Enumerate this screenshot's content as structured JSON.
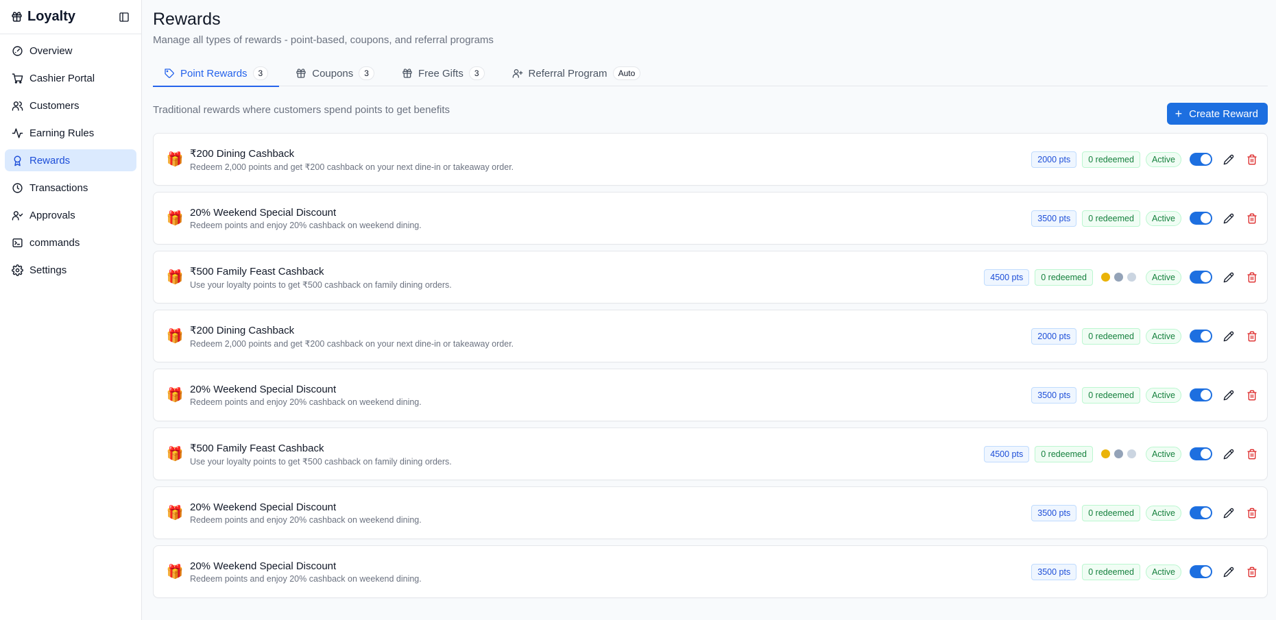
{
  "app": {
    "title": "Loyalty"
  },
  "sidebar": {
    "items": [
      {
        "label": "Overview",
        "icon": "gauge-icon",
        "active": false
      },
      {
        "label": "Cashier Portal",
        "icon": "cart-icon",
        "active": false
      },
      {
        "label": "Customers",
        "icon": "users-icon",
        "active": false
      },
      {
        "label": "Earning Rules",
        "icon": "activity-icon",
        "active": false
      },
      {
        "label": "Rewards",
        "icon": "award-icon",
        "active": true
      },
      {
        "label": "Transactions",
        "icon": "clock-icon",
        "active": false
      },
      {
        "label": "Approvals",
        "icon": "user-check-icon",
        "active": false
      },
      {
        "label": "commands",
        "icon": "terminal-icon",
        "active": false
      },
      {
        "label": "Settings",
        "icon": "gear-icon",
        "active": false
      }
    ]
  },
  "header": {
    "title": "Rewards",
    "subtitle": "Manage all types of rewards - point-based, coupons, and referral programs"
  },
  "tabs": [
    {
      "label": "Point Rewards",
      "count": "3",
      "icon": "tag-icon",
      "active": true
    },
    {
      "label": "Coupons",
      "count": "3",
      "icon": "gift-icon",
      "active": false
    },
    {
      "label": "Free Gifts",
      "count": "3",
      "icon": "gift-icon",
      "active": false
    },
    {
      "label": "Referral Program",
      "count": "Auto",
      "icon": "user-plus-icon",
      "active": false
    }
  ],
  "main": {
    "helper": "Traditional rewards where customers spend points to get benefits",
    "create_label": "Create Reward"
  },
  "colors": {
    "accent": "#1d6fe0",
    "gold": "#eab308",
    "silver": "#94a3b8",
    "platinum": "#cbd5e1",
    "danger": "#dc2626"
  },
  "rewards": [
    {
      "name": "₹200 Dining Cashback",
      "desc": "Redeem 2,000 points and get ₹200 cashback on your next dine-in or takeaway order.",
      "points": "2000 pts",
      "redeemed": "0 redeemed",
      "status": "Active",
      "tiers": false,
      "enabled": true
    },
    {
      "name": "20% Weekend Special Discount",
      "desc": "Redeem points and enjoy 20% cashback on weekend dining.",
      "points": "3500 pts",
      "redeemed": "0 redeemed",
      "status": "Active",
      "tiers": false,
      "enabled": true
    },
    {
      "name": "₹500 Family Feast Cashback",
      "desc": "Use your loyalty points to get ₹500 cashback on family dining orders.",
      "points": "4500 pts",
      "redeemed": "0 redeemed",
      "status": "Active",
      "tiers": true,
      "enabled": true
    },
    {
      "name": "₹200 Dining Cashback",
      "desc": "Redeem 2,000 points and get ₹200 cashback on your next dine-in or takeaway order.",
      "points": "2000 pts",
      "redeemed": "0 redeemed",
      "status": "Active",
      "tiers": false,
      "enabled": true
    },
    {
      "name": "20% Weekend Special Discount",
      "desc": "Redeem points and enjoy 20% cashback on weekend dining.",
      "points": "3500 pts",
      "redeemed": "0 redeemed",
      "status": "Active",
      "tiers": false,
      "enabled": true
    },
    {
      "name": "₹500 Family Feast Cashback",
      "desc": "Use your loyalty points to get ₹500 cashback on family dining orders.",
      "points": "4500 pts",
      "redeemed": "0 redeemed",
      "status": "Active",
      "tiers": true,
      "enabled": true
    },
    {
      "name": "20% Weekend Special Discount",
      "desc": "Redeem points and enjoy 20% cashback on weekend dining.",
      "points": "3500 pts",
      "redeemed": "0 redeemed",
      "status": "Active",
      "tiers": false,
      "enabled": true
    },
    {
      "name": "20% Weekend Special Discount",
      "desc": "Redeem points and enjoy 20% cashback on weekend dining.",
      "points": "3500 pts",
      "redeemed": "0 redeemed",
      "status": "Active",
      "tiers": false,
      "enabled": true
    }
  ]
}
